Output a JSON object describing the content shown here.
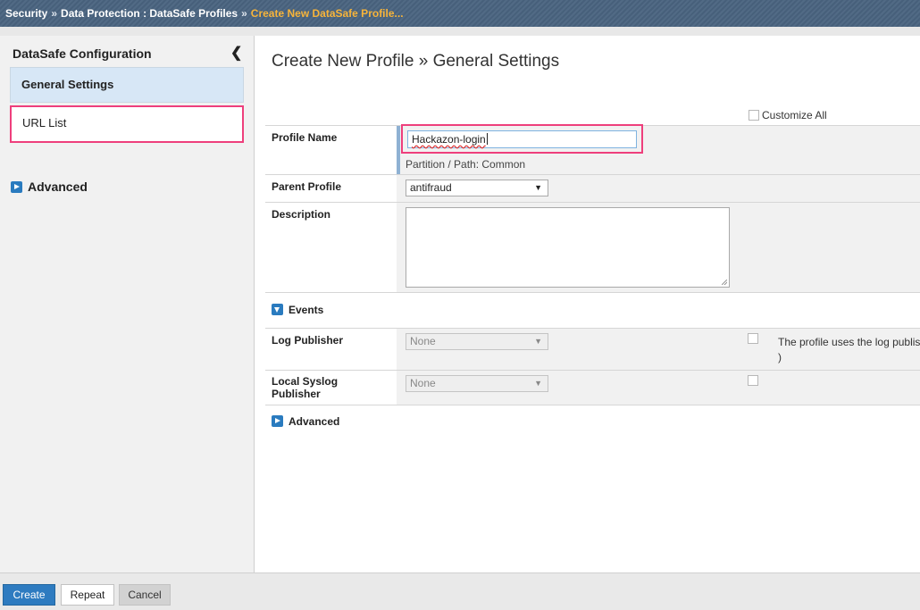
{
  "breadcrumb": {
    "items": [
      "Security",
      "Data Protection : DataSafe Profiles"
    ],
    "current": "Create New DataSafe Profile...",
    "separator": "»"
  },
  "sidebar": {
    "title": "DataSafe Configuration",
    "items": [
      {
        "label": "General Settings",
        "active": true
      },
      {
        "label": "URL List",
        "active": false,
        "highlighted": true
      }
    ],
    "advanced_label": "Advanced"
  },
  "main": {
    "title": "Create New Profile » General Settings",
    "customize_all_label": "Customize All",
    "profile_name": {
      "label": "Profile Name",
      "value": "Hackazon-login",
      "partition": "Partition / Path: Common"
    },
    "parent_profile": {
      "label": "Parent Profile",
      "selected": "antifraud"
    },
    "description": {
      "label": "Description",
      "value": ""
    },
    "events": {
      "label": "Events",
      "log_publisher": {
        "label": "Log Publisher",
        "selected": "None",
        "note": "The profile uses the log publis",
        "note_line2": ")"
      },
      "local_syslog_publisher": {
        "label": "Local Syslog Publisher",
        "selected": "None"
      }
    },
    "advanced_label": "Advanced"
  },
  "buttons": {
    "create": "Create",
    "repeat": "Repeat",
    "cancel": "Cancel"
  },
  "colors": {
    "topbar": "#4a6480",
    "breadcrumb_current": "#f7b43a",
    "highlight": "#ee3f7c",
    "primary_button": "#2e7bc0",
    "active_nav": "#d7e7f6"
  }
}
